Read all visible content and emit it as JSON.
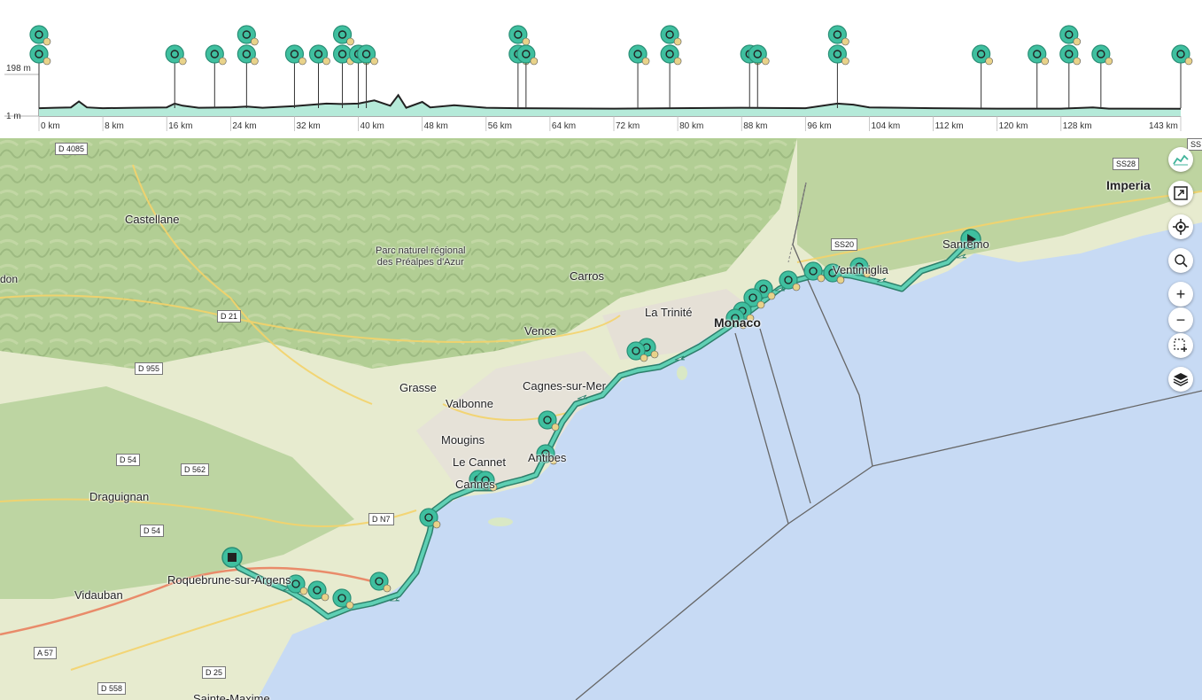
{
  "profile": {
    "y_max_label": "198 m",
    "y_min_label": "1 m",
    "distance_labels": [
      "0 km",
      "8 km",
      "16 km",
      "24 km",
      "32 km",
      "40 km",
      "48 km",
      "56 km",
      "64 km",
      "72 km",
      "80 km",
      "88 km",
      "96 km",
      "104 km",
      "112 km",
      "120 km",
      "128 km",
      "143 km"
    ],
    "total_km": 143,
    "elevation_profile_km": [
      [
        0,
        8
      ],
      [
        2,
        10
      ],
      [
        4,
        12
      ],
      [
        5,
        40
      ],
      [
        6,
        12
      ],
      [
        8,
        8
      ],
      [
        12,
        10
      ],
      [
        16,
        12
      ],
      [
        17,
        30
      ],
      [
        18,
        20
      ],
      [
        20,
        10
      ],
      [
        24,
        12
      ],
      [
        26,
        16
      ],
      [
        28,
        10
      ],
      [
        32,
        18
      ],
      [
        36,
        30
      ],
      [
        38,
        28
      ],
      [
        40,
        30
      ],
      [
        42,
        45
      ],
      [
        44,
        20
      ],
      [
        45,
        70
      ],
      [
        46,
        10
      ],
      [
        48,
        38
      ],
      [
        49,
        12
      ],
      [
        52,
        22
      ],
      [
        56,
        10
      ],
      [
        60,
        8
      ],
      [
        72,
        6
      ],
      [
        88,
        10
      ],
      [
        96,
        8
      ],
      [
        100,
        30
      ],
      [
        102,
        25
      ],
      [
        104,
        12
      ],
      [
        112,
        8
      ],
      [
        120,
        6
      ],
      [
        128,
        6
      ],
      [
        132,
        12
      ],
      [
        134,
        6
      ],
      [
        143,
        5
      ]
    ],
    "waypoint_km": [
      0,
      17,
      22,
      26,
      32,
      35,
      38,
      40,
      41,
      60,
      61,
      75,
      79,
      89,
      90,
      100,
      118,
      125,
      129,
      133,
      143
    ]
  },
  "map": {
    "places": {
      "castellane": "Castellane",
      "parc": "Parc naturel régional\ndes Préalpes d'Azur",
      "carros": "Carros",
      "la_trinite": "La Trinité",
      "monaco": "Monaco",
      "vence": "Vence",
      "grasse": "Grasse",
      "valbonne": "Valbonne",
      "cagnes": "Cagnes-sur-Mer",
      "mougins": "Mougins",
      "le_cannet": "Le Cannet",
      "antibes": "Antibes",
      "cannes": "Cannes",
      "draguignan": "Draguignan",
      "roquebrune": "Roquebrune-sur-Argens",
      "vidauban": "Vidauban",
      "sainte_maxime": "Sainte-Maxime",
      "ventimiglia": "Ventimiglia",
      "sanremo": "Sanremo",
      "imperia": "Imperia",
      "don": "don"
    },
    "roads": [
      "D 4085",
      "D 21",
      "D 955",
      "D 54",
      "D 562",
      "D 54",
      "D N7",
      "A 57",
      "D 25",
      "D 558",
      "SS20",
      "SS28",
      "SS"
    ],
    "colors": {
      "route": "#3fb39a",
      "marker": "#3fbf9f",
      "sea": "#c7daf4",
      "land": "#e8eccf"
    }
  },
  "controls": {
    "elevation": "elevation-icon",
    "fullscreen": "fullscreen-icon",
    "locate": "locate-icon",
    "search": "search-icon",
    "zoom_in": "+",
    "zoom_out": "−",
    "select": "area-select-icon",
    "layers": "layers-icon"
  }
}
